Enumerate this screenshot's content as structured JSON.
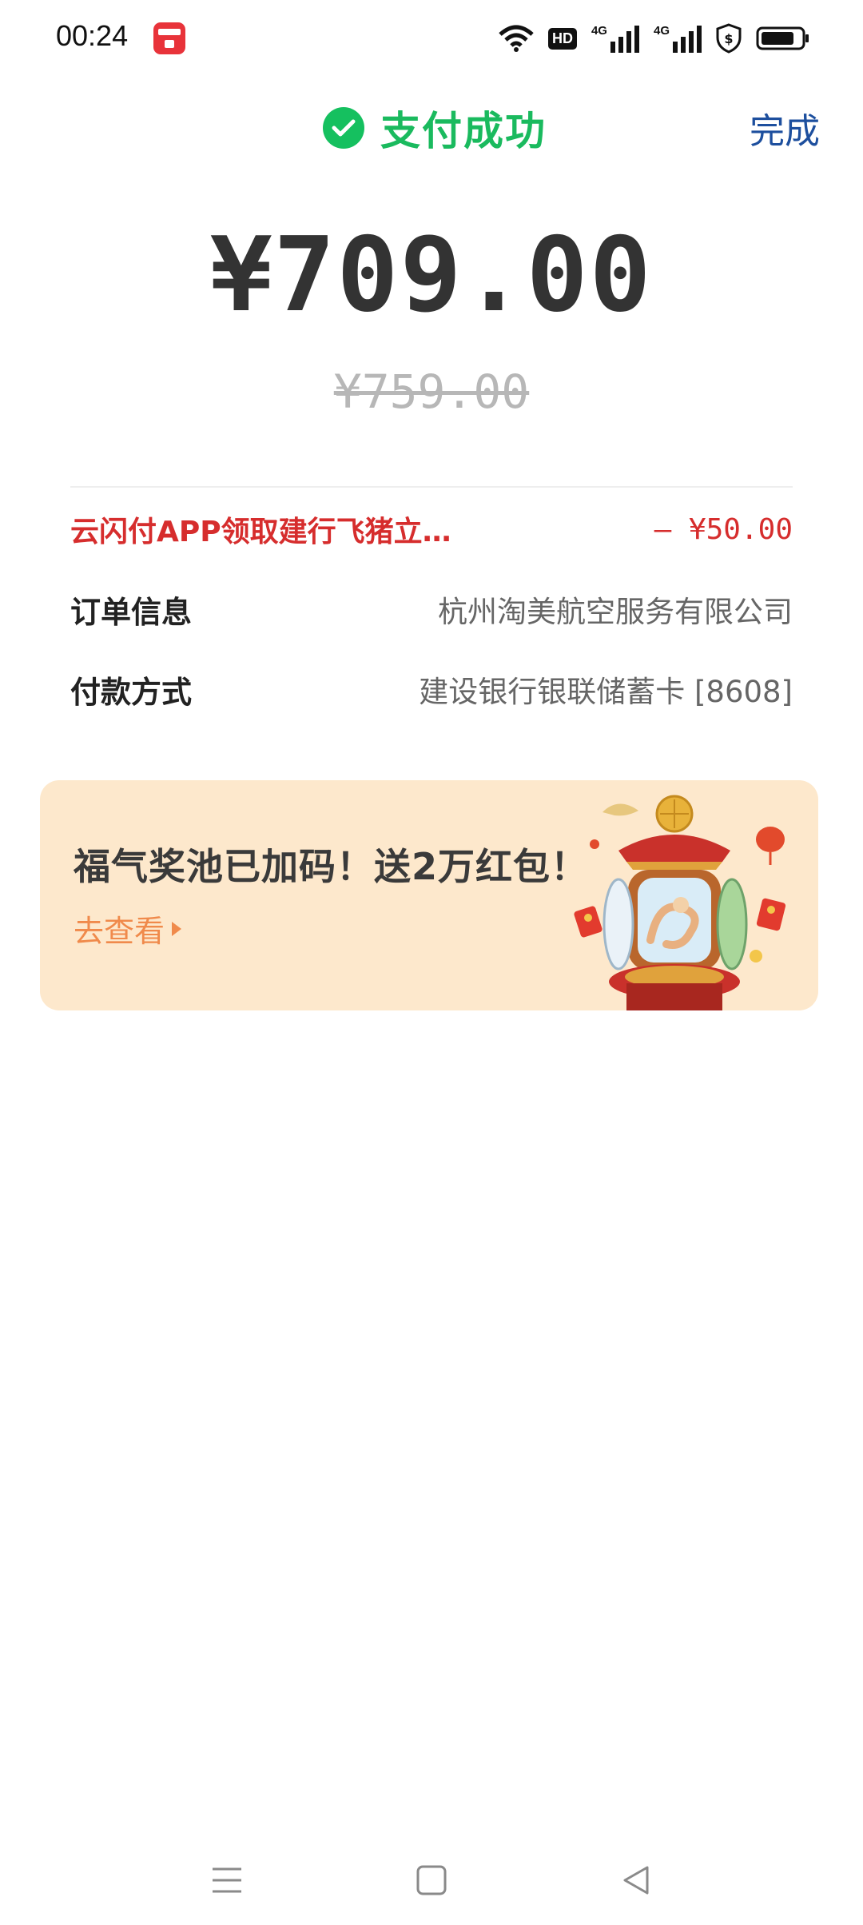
{
  "status_bar": {
    "time": "00:24",
    "hd_label": "HD",
    "network_1": "4G",
    "network_2": "4G"
  },
  "header": {
    "status_text": "支付成功",
    "done_label": "完成"
  },
  "payment": {
    "amount": "¥709.00",
    "original_amount": "¥759.00"
  },
  "discount": {
    "label": "云闪付APP领取建行飞猪立…",
    "value": "– ¥50.00"
  },
  "order": {
    "label": "订单信息",
    "value": "杭州淘美航空服务有限公司"
  },
  "payment_method": {
    "label": "付款方式",
    "value": "建设银行银联储蓄卡 [8608]"
  },
  "promo": {
    "title": "福气奖池已加码！送2万红包！",
    "link": "去查看"
  },
  "colors": {
    "success_green": "#1aba5e",
    "done_blue": "#1d4f9e",
    "discount_red": "#d62d2d",
    "promo_bg": "#fde8cc",
    "promo_link": "#f08a4b"
  },
  "icons": {
    "status": [
      "app-notification-icon",
      "wifi-icon",
      "hd-voice-icon",
      "signal-icon",
      "security-shield-icon",
      "battery-icon"
    ],
    "header": "check-circle-icon",
    "promo": "triangle-right-icon",
    "nav": [
      "menu-icon",
      "home-square-icon",
      "back-triangle-icon"
    ]
  }
}
